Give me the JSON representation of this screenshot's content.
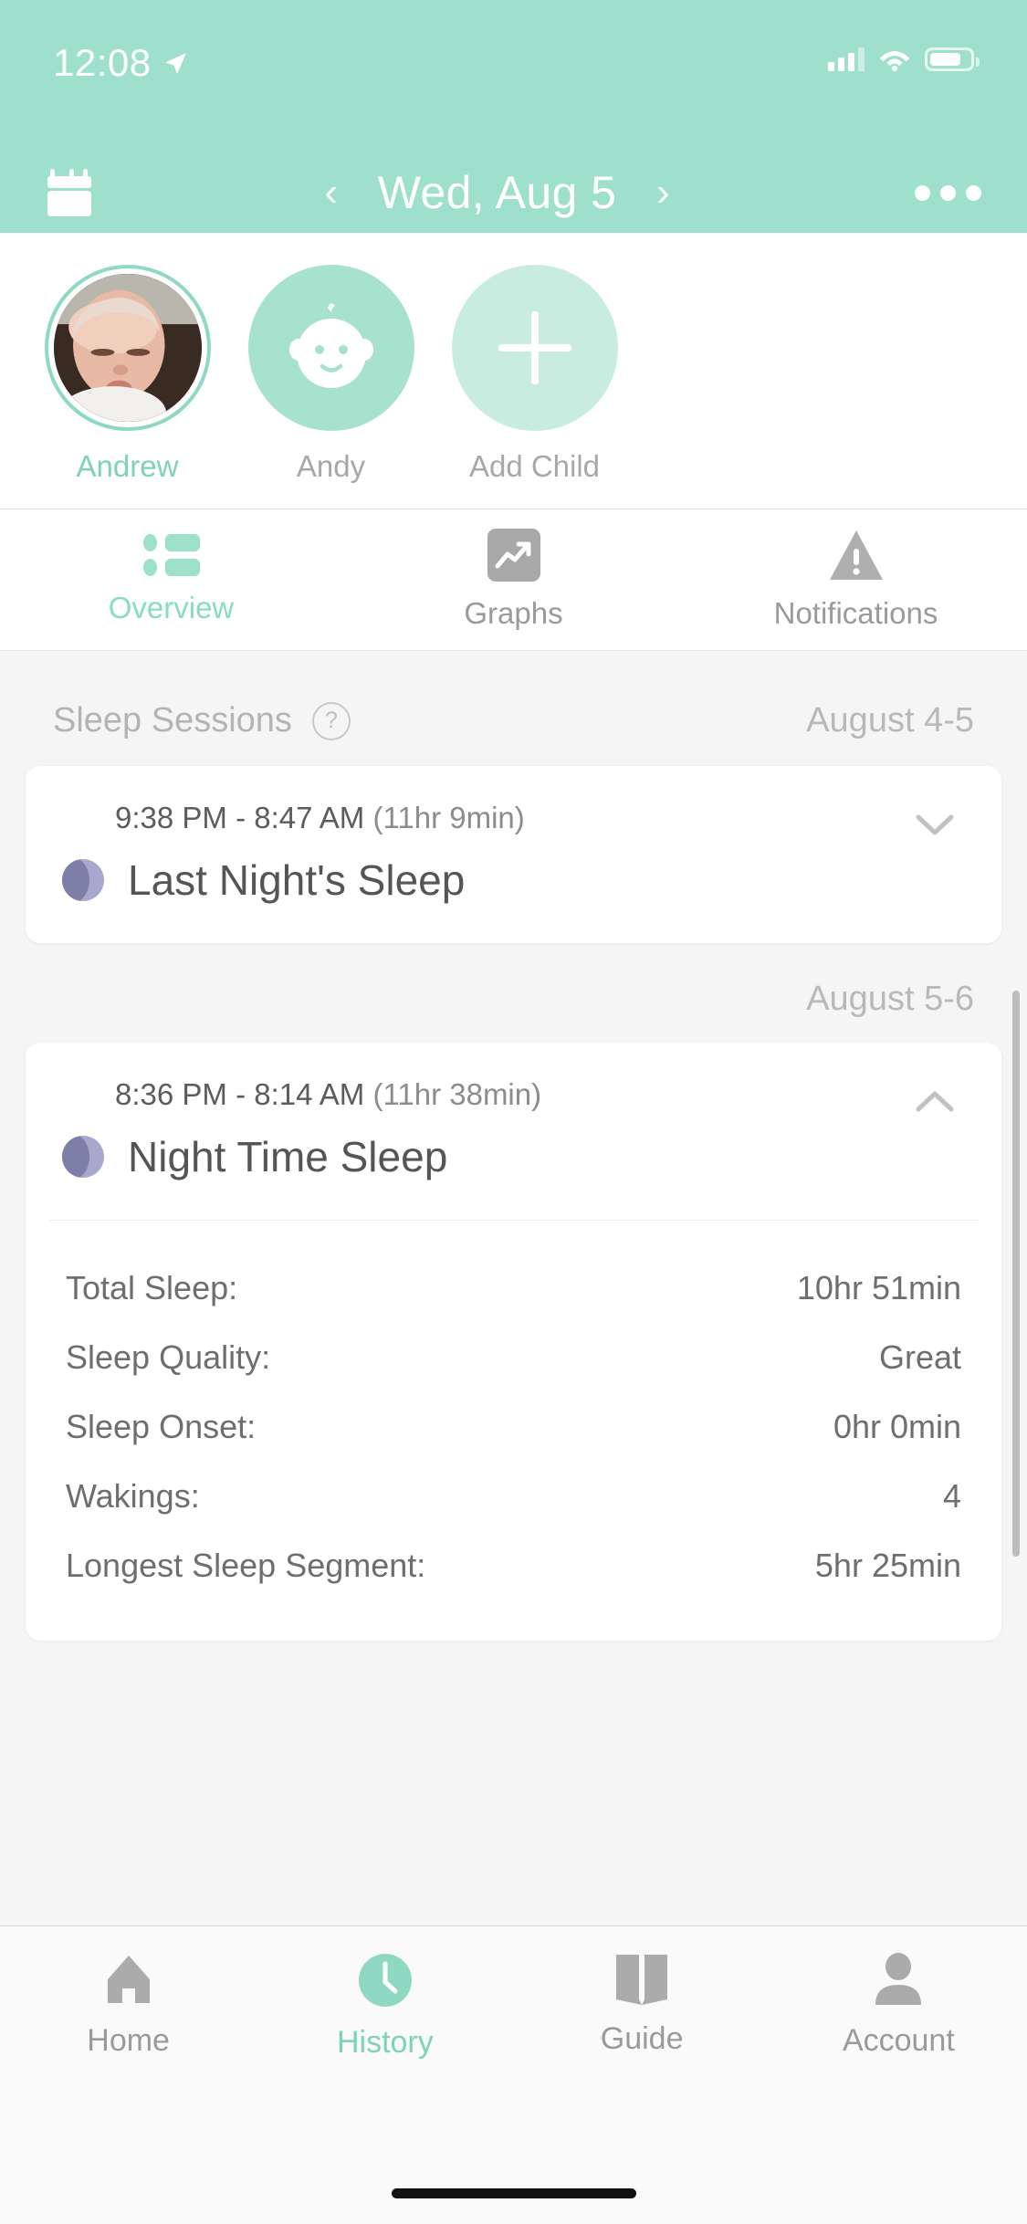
{
  "status_bar": {
    "time": "12:08",
    "location_icon": "location-arrow-icon",
    "signal_icon": "cellular-signal-icon",
    "wifi_icon": "wifi-icon",
    "battery_icon": "battery-icon"
  },
  "header": {
    "background_color": "#9FE0CC",
    "calendar_icon": "calendar-icon",
    "prev_label": "‹",
    "date": "Wed, Aug 5",
    "next_label": "›",
    "more_icon": "more-options-icon"
  },
  "children": {
    "items": [
      {
        "name": "Andrew",
        "selected": true,
        "avatar": "photo-avatar"
      },
      {
        "name": "Andy",
        "selected": false,
        "avatar": "baby-face-icon"
      },
      {
        "name": "Add Child",
        "selected": false,
        "avatar": "plus-icon"
      }
    ]
  },
  "tabs": {
    "items": [
      {
        "label": "Overview",
        "icon": "list-icon",
        "active": true
      },
      {
        "label": "Graphs",
        "icon": "trend-chart-icon",
        "active": false
      },
      {
        "label": "Notifications",
        "icon": "warning-triangle-icon",
        "active": false
      }
    ]
  },
  "main": {
    "section_title": "Sleep Sessions",
    "help_label": "?",
    "groups": [
      {
        "date_range": "August 4-5",
        "session": {
          "times": "9:38 PM - 8:47 AM",
          "duration": "(11hr 9min)",
          "title": "Last Night's Sleep",
          "expanded": false,
          "chevron": "chevron-down-icon"
        }
      },
      {
        "date_range": "August 5-6",
        "session": {
          "times": "8:36 PM - 8:14 AM",
          "duration": "(11hr 38min)",
          "title": "Night Time Sleep",
          "expanded": true,
          "chevron": "chevron-up-icon",
          "details": [
            {
              "label": "Total Sleep:",
              "value": "10hr 51min"
            },
            {
              "label": "Sleep Quality:",
              "value": "Great"
            },
            {
              "label": "Sleep Onset:",
              "value": "0hr 0min"
            },
            {
              "label": "Wakings:",
              "value": "4"
            },
            {
              "label": "Longest Sleep Segment:",
              "value": "5hr 25min"
            }
          ]
        }
      }
    ]
  },
  "bottom_nav": {
    "items": [
      {
        "label": "Home",
        "icon": "home-icon",
        "active": false
      },
      {
        "label": "History",
        "icon": "clock-icon",
        "active": true
      },
      {
        "label": "Guide",
        "icon": "book-icon",
        "active": false
      },
      {
        "label": "Account",
        "icon": "person-icon",
        "active": false
      }
    ]
  },
  "colors": {
    "accent_teal": "#9FE0CC",
    "accent_teal_text": "#7ED3B5",
    "moon_dark": "#7E7FA8",
    "moon_light": "#A7A9CC",
    "gray_text": "#9A9A9A"
  }
}
